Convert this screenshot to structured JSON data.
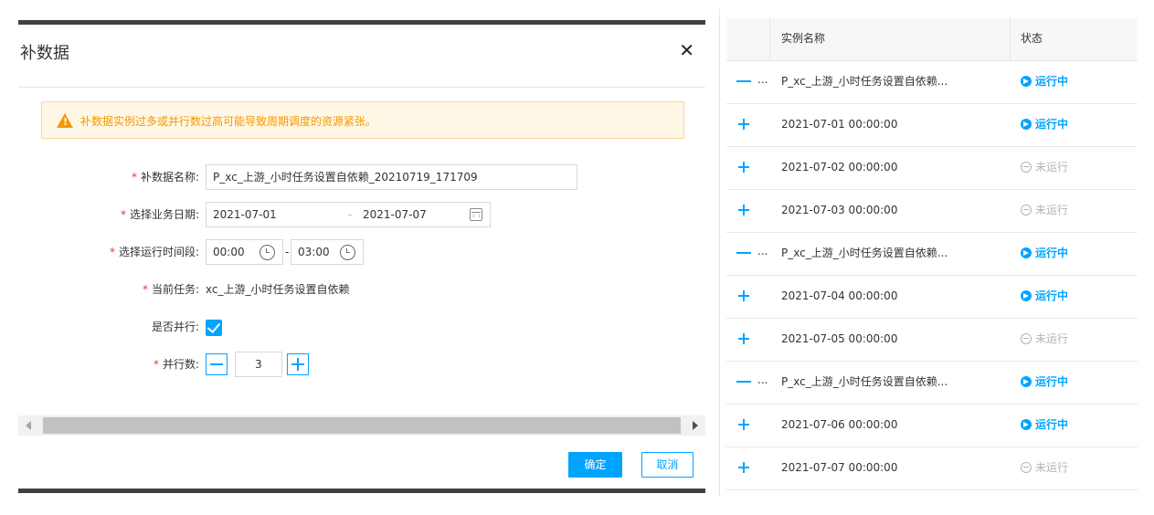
{
  "dialog": {
    "title": "补数据",
    "close_icon": "close-icon",
    "warning": "补数据实例过多或并行数过高可能导致周期调度的资源紧张。",
    "fields": {
      "name_label": "补数据名称:",
      "name_value": "P_xc_上游_小时任务设置自依赖_20210719_171709",
      "date_label": "选择业务日期:",
      "date_start": "2021-07-01",
      "date_sep": "-",
      "date_end": "2021-07-07",
      "time_label": "选择运行时间段:",
      "time_start": "00:00",
      "time_sep": "-",
      "time_end": "03:00",
      "task_label": "当前任务:",
      "task_value": "xc_上游_小时任务设置自依赖",
      "parallel_label": "是否并行:",
      "parallel_checked": true,
      "count_label": "并行数:",
      "count_value": "3",
      "required_mark": "*"
    },
    "buttons": {
      "confirm": "确定",
      "cancel": "取消"
    },
    "colors": {
      "accent": "#00a4ff",
      "warning": "#f39800",
      "required": "#e53935"
    }
  },
  "instances": {
    "headers": {
      "name": "实例名称",
      "status": "状态"
    },
    "ellipsis": "...",
    "rows": [
      {
        "expander": "minus",
        "name": "P_xc_上游_小时任务设置自依赖...",
        "status": "运行中",
        "state": "running"
      },
      {
        "expander": "plus",
        "name": "2021-07-01 00:00:00",
        "status": "运行中",
        "state": "running"
      },
      {
        "expander": "plus",
        "name": "2021-07-02 00:00:00",
        "status": "未运行",
        "state": "idle"
      },
      {
        "expander": "plus",
        "name": "2021-07-03 00:00:00",
        "status": "未运行",
        "state": "idle"
      },
      {
        "expander": "minus",
        "name": "P_xc_上游_小时任务设置自依赖...",
        "status": "运行中",
        "state": "running"
      },
      {
        "expander": "plus",
        "name": "2021-07-04 00:00:00",
        "status": "运行中",
        "state": "running"
      },
      {
        "expander": "plus",
        "name": "2021-07-05 00:00:00",
        "status": "未运行",
        "state": "idle"
      },
      {
        "expander": "minus",
        "name": "P_xc_上游_小时任务设置自依赖...",
        "status": "运行中",
        "state": "running"
      },
      {
        "expander": "plus",
        "name": "2021-07-06 00:00:00",
        "status": "运行中",
        "state": "running"
      },
      {
        "expander": "plus",
        "name": "2021-07-07 00:00:00",
        "status": "未运行",
        "state": "idle"
      }
    ]
  }
}
